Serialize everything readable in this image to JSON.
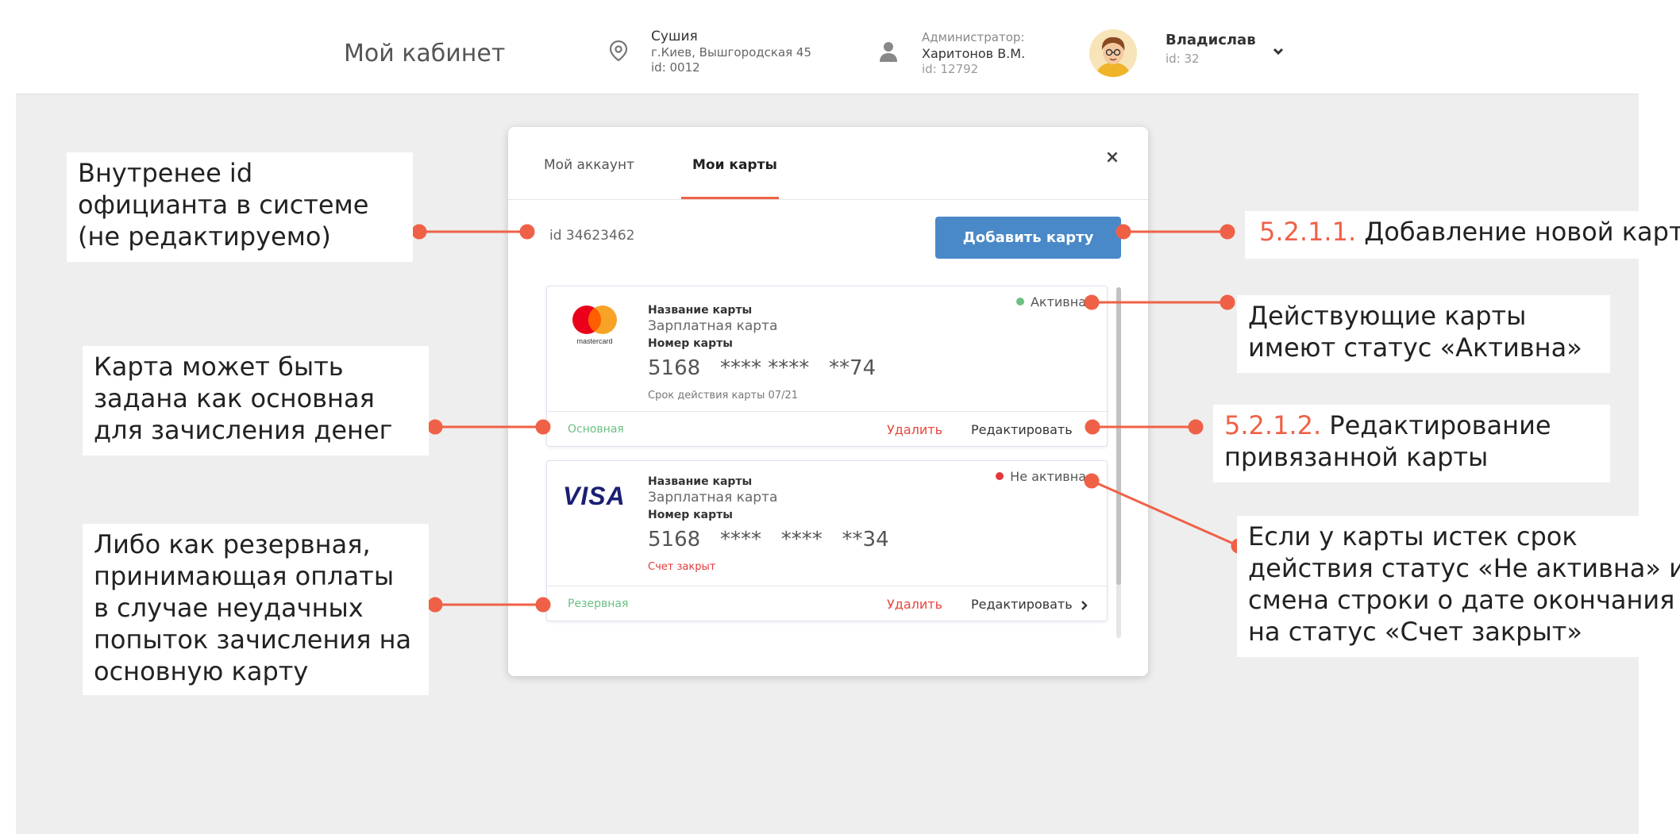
{
  "header": {
    "page_title": "Мой кабинет",
    "location": {
      "name": "Сушия",
      "address": "г.Киев, Вышгородская 45",
      "id": "id: 0012",
      "icon": "location-pin-icon"
    },
    "admin": {
      "role": "Администратор:",
      "name": "Харитонов В.М.",
      "id": "id: 12792",
      "icon": "person-icon"
    },
    "user": {
      "name": "Владислав",
      "id": "id: 32"
    }
  },
  "modal": {
    "tabs": [
      {
        "label": "Мой аккаунт",
        "active": false
      },
      {
        "label": "Мои карты",
        "active": true
      }
    ],
    "close_icon": "×",
    "waiter_id": "id 34623462",
    "add_card_label": "Добавить карту",
    "cards": [
      {
        "brand": "mastercard",
        "brand_text": "mastercard",
        "name_label": "Название карты",
        "name": "Зарплатная карта",
        "number_label": "Номер карты",
        "number": "5168   **** ****   **74",
        "expiry": "Срок действия карты 07/21",
        "status": "Активна",
        "status_color": "#6cc083",
        "type_label": "Основная",
        "delete_label": "Удалить",
        "edit_label": "Редактировать"
      },
      {
        "brand": "visa",
        "brand_text": "VISA",
        "name_label": "Название карты",
        "name": "Зарплатная карта",
        "number_label": "Номер карты",
        "number": "5168   ****   ****   **34",
        "expiry": "Счет закрыт",
        "status": "Не активна",
        "status_color": "#e2393d",
        "type_label": "Резервная",
        "delete_label": "Удалить",
        "edit_label": "Редактировать"
      }
    ]
  },
  "annotations": {
    "waiter_id_note": [
      "Внутренее id",
      "официанта в системе",
      "(не редактируемо)"
    ],
    "main_card_note": [
      "Карта может быть",
      "задана как основная",
      "для зачисления денег"
    ],
    "reserve_card_note": [
      "Либо как резервная,",
      "принимающая оплаты",
      "в случае неудачных",
      "попыток зачисления на",
      "основную карту"
    ],
    "add_card_note": {
      "number": "5.2.1.1.",
      "text": " Добавление новой карты"
    },
    "active_status_note": [
      "Действующие карты",
      "имеют статус «Активна»"
    ],
    "edit_card_note": {
      "number": "5.2.1.2.",
      "text": " Редактирование",
      "line2": "привязанной карты"
    },
    "inactive_status_note": [
      "Если у карты истек срок",
      "действия статус «Не активна» и",
      "смена строки о дате окончания",
      "на статус «Счет закрыт»"
    ]
  },
  "colors": {
    "accent": "#ef6147",
    "button": "#4a89c8",
    "active": "#6cc083",
    "inactive": "#e2393d",
    "background": "#eeeeee"
  }
}
